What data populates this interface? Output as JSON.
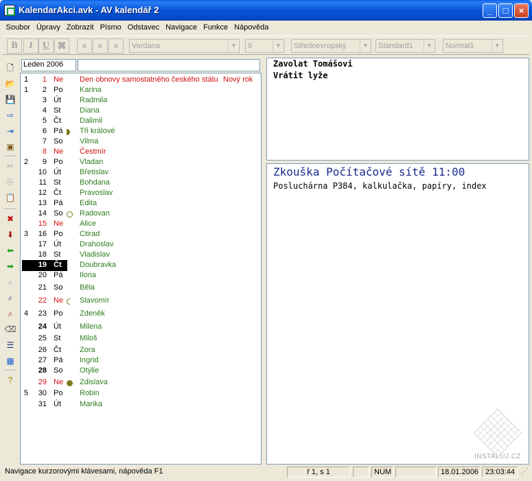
{
  "window": {
    "title": "KalendarAkci.avk - AV kalendář 2"
  },
  "menu": [
    "Soubor",
    "Úpravy",
    "Zobrazit",
    "Písmo",
    "Odstavec",
    "Navigace",
    "Funkce",
    "Nápověda"
  ],
  "format_toolbar": {
    "bold": "B",
    "italic": "I",
    "underline": "U",
    "font": "Verdana",
    "size": "9",
    "charset": "Středoevropský",
    "paragraph": "Standard1",
    "style": "Normal1"
  },
  "calendar": {
    "month_label": "Leden  2006",
    "rows": [
      {
        "week": "1",
        "day": "1",
        "dow": "Ne",
        "name": "Den obnovy samostatného českého státu",
        "holiday": "Nový rok",
        "type": "holiday"
      },
      {
        "week": "1",
        "day": "2",
        "dow": "Po",
        "name": "Karina"
      },
      {
        "week": "",
        "day": "3",
        "dow": "Út",
        "name": "Radmila"
      },
      {
        "week": "",
        "day": "4",
        "dow": "St",
        "name": "Diana"
      },
      {
        "week": "",
        "day": "5",
        "dow": "Čt",
        "name": "Dalimil"
      },
      {
        "week": "",
        "day": "6",
        "dow": "Pá",
        "name": "Tři králové",
        "moon": "first"
      },
      {
        "week": "",
        "day": "7",
        "dow": "So",
        "name": "Vilma"
      },
      {
        "week": "",
        "day": "8",
        "dow": "Ne",
        "name": "Čestmír",
        "type": "holiday"
      },
      {
        "week": "2",
        "day": "9",
        "dow": "Po",
        "name": "Vladan"
      },
      {
        "week": "",
        "day": "10",
        "dow": "Út",
        "name": "Břetislav"
      },
      {
        "week": "",
        "day": "11",
        "dow": "St",
        "name": "Bohdana"
      },
      {
        "week": "",
        "day": "12",
        "dow": "Čt",
        "name": "Pravoslav"
      },
      {
        "week": "",
        "day": "13",
        "dow": "Pá",
        "name": "Edita"
      },
      {
        "week": "",
        "day": "14",
        "dow": "So",
        "name": "Radovan",
        "moon": "full"
      },
      {
        "week": "",
        "day": "15",
        "dow": "Ne",
        "name": "Alice",
        "type": "sunday"
      },
      {
        "week": "3",
        "day": "16",
        "dow": "Po",
        "name": "Ctirad"
      },
      {
        "week": "",
        "day": "17",
        "dow": "Út",
        "name": "Drahoslav"
      },
      {
        "week": "",
        "day": "18",
        "dow": "St",
        "name": "Vladislav"
      },
      {
        "week": "",
        "day": "19",
        "dow": "Čt",
        "name": "Doubravka",
        "type": "selected"
      },
      {
        "week": "",
        "day": "20",
        "dow": "Pá",
        "name": "Ilona"
      },
      {
        "week": "",
        "day": "21",
        "dow": "So",
        "name": "Běla"
      },
      {
        "week": "",
        "day": "22",
        "dow": "Ne",
        "name": "Slavomír",
        "moon": "last",
        "type": "sunday"
      },
      {
        "week": "4",
        "day": "23",
        "dow": "Po",
        "name": "Zdeněk"
      },
      {
        "week": "",
        "day": "24",
        "dow": "Út",
        "name": "Milena",
        "type": "bold"
      },
      {
        "week": "",
        "day": "25",
        "dow": "St",
        "name": "Miloš"
      },
      {
        "week": "",
        "day": "26",
        "dow": "Čt",
        "name": "Zora"
      },
      {
        "week": "",
        "day": "27",
        "dow": "Pá",
        "name": "Ingrid"
      },
      {
        "week": "",
        "day": "28",
        "dow": "So",
        "name": "Otýlie",
        "type": "bold"
      },
      {
        "week": "",
        "day": "29",
        "dow": "Ne",
        "name": "Zdislava",
        "moon": "new",
        "type": "sunday"
      },
      {
        "week": "5",
        "day": "30",
        "dow": "Po",
        "name": "Robin"
      },
      {
        "week": "",
        "day": "31",
        "dow": "Út",
        "name": "Marika"
      }
    ]
  },
  "notes": [
    "Zavolat Tomášovi",
    "Vrátit lyže"
  ],
  "event": {
    "title": "Zkouška Počítačové sítě 11:00",
    "body": "Posluchárna P384, kalkulačka, papíry, index"
  },
  "watermark": "INSTALUJ.CZ",
  "status": {
    "hint": "Navigace kurzorovými klávesami, nápověda F1",
    "position": "ř 1, s 1",
    "num": "NUM",
    "date": "18.01.2006",
    "time": "23:03:44"
  }
}
